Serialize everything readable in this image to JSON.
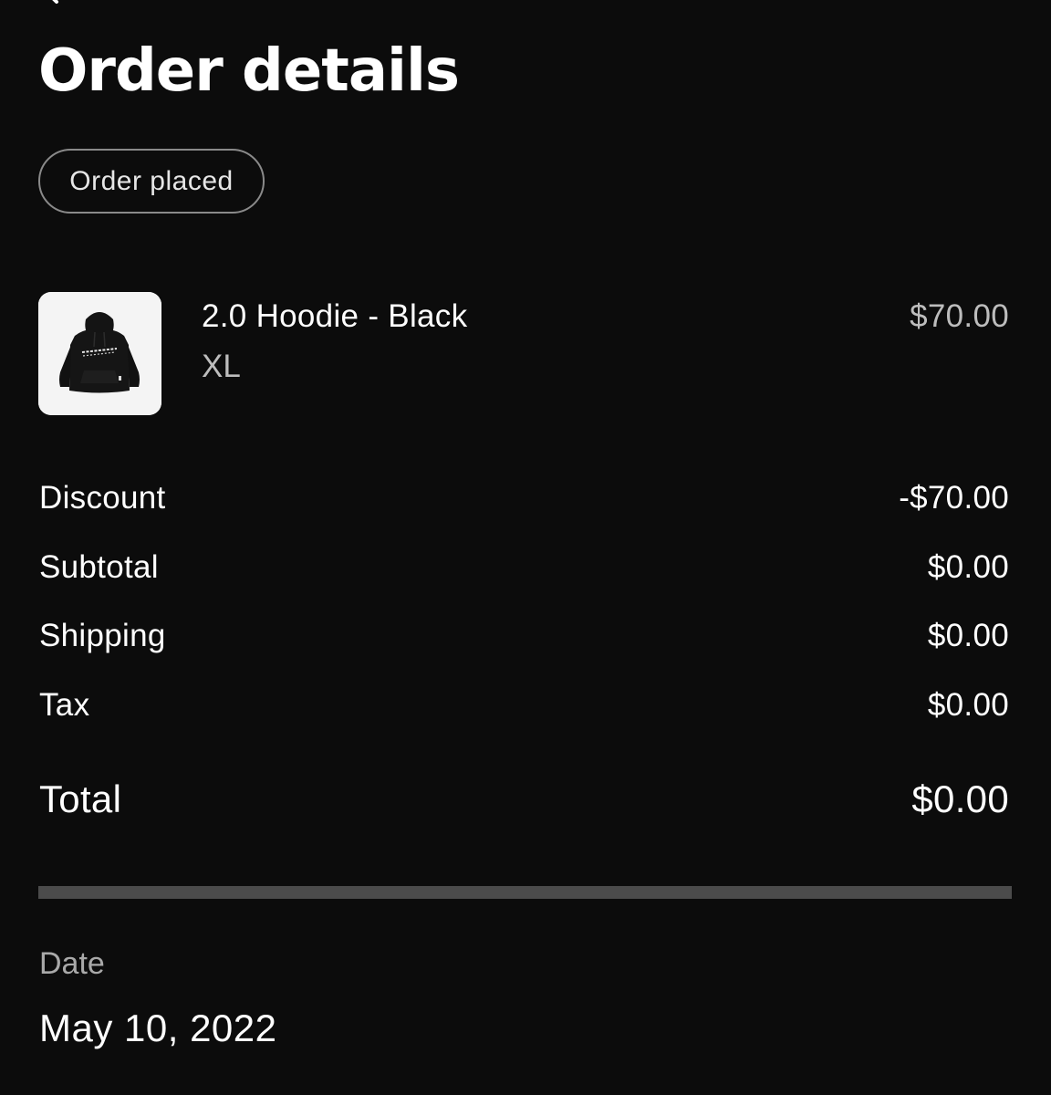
{
  "header": {
    "back_icon": "chevron-left-icon",
    "title": "Order details"
  },
  "status": {
    "label": "Order placed"
  },
  "item": {
    "image_icon": "hoodie-image",
    "image_text": "OVERTHINK GANG",
    "name": "2.0 Hoodie - Black",
    "variant": "XL",
    "price": "$70.00"
  },
  "summary": {
    "discount_label": "Discount",
    "discount_value": "-$70.00",
    "subtotal_label": "Subtotal",
    "subtotal_value": "$0.00",
    "shipping_label": "Shipping",
    "shipping_value": "$0.00",
    "tax_label": "Tax",
    "tax_value": "$0.00",
    "total_label": "Total",
    "total_value": "$0.00"
  },
  "order_date": {
    "label": "Date",
    "value": "May 10, 2022"
  },
  "colors": {
    "background": "#0c0c0c",
    "text_primary": "#ffffff",
    "text_secondary": "#bdbdbd",
    "badge_border": "#8a8a8a",
    "divider": "#4b4b4b"
  }
}
